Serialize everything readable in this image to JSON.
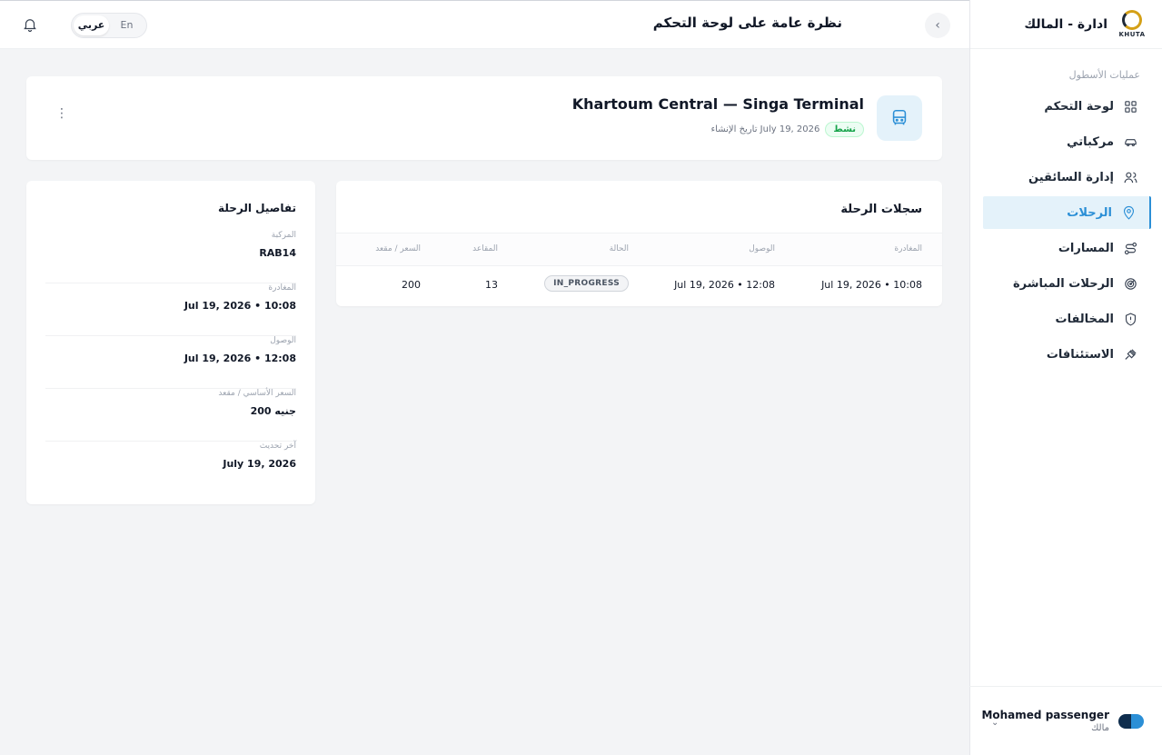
{
  "app": {
    "brand_title": "ادارة - المالك",
    "logo_text": "KHUTA"
  },
  "sidebar": {
    "section_label": "عمليات الأسطول",
    "items": [
      {
        "label": "لوحة التحكم",
        "icon": "dashboard-icon"
      },
      {
        "label": "مركباتي",
        "icon": "car-icon"
      },
      {
        "label": "إدارة السائقين",
        "icon": "users-icon"
      },
      {
        "label": "الرحلات",
        "icon": "map-pin-icon",
        "active": true
      },
      {
        "label": "المسارات",
        "icon": "route-icon"
      },
      {
        "label": "الرحلات المباشرة",
        "icon": "radar-icon"
      },
      {
        "label": "المخالفات",
        "icon": "shield-alert-icon"
      },
      {
        "label": "الاستئنافات",
        "icon": "gavel-icon"
      }
    ],
    "user": {
      "name": "Mohamed passenger",
      "role": "مالك"
    }
  },
  "topbar": {
    "page_title": "نظرة عامة على لوحة التحكم",
    "lang_en": "En",
    "lang_ar": "عربي",
    "active_lang": "ar"
  },
  "trip": {
    "title": "Khartoum Central — Singa Terminal",
    "status_badge": "نشط",
    "created": "تاريخ الإنشاء July 19, 2026"
  },
  "records": {
    "title": "سجلات الرحلة",
    "columns": {
      "departure": "المغادرة",
      "arrival": "الوصول",
      "status": "الحالة",
      "seats": "المقاعد",
      "price": "السعر / مقعد"
    },
    "rows": [
      {
        "departure": "Jul 19, 2026 • 10:08",
        "arrival": "Jul 19, 2026 • 12:08",
        "status": "IN_PROGRESS",
        "seats": "13",
        "price": "200"
      }
    ]
  },
  "details": {
    "title": "تفاصيل الرحلة",
    "items": [
      {
        "label": "المركبة",
        "value": "RAB14"
      },
      {
        "label": "المغادرة",
        "value": "Jul 19, 2026 • 10:08"
      },
      {
        "label": "الوصول",
        "value": "Jul 19, 2026 • 12:08"
      },
      {
        "label": "السعر الأساسي / مقعد",
        "value": "200 جنيه"
      },
      {
        "label": "آخر تحديث",
        "value": "July 19, 2026"
      }
    ]
  },
  "colors": {
    "accent": "#2b8fd6",
    "active_bg": "#e4f2fa",
    "success": "#16a34a",
    "page_bg": "#f3f4f6"
  }
}
